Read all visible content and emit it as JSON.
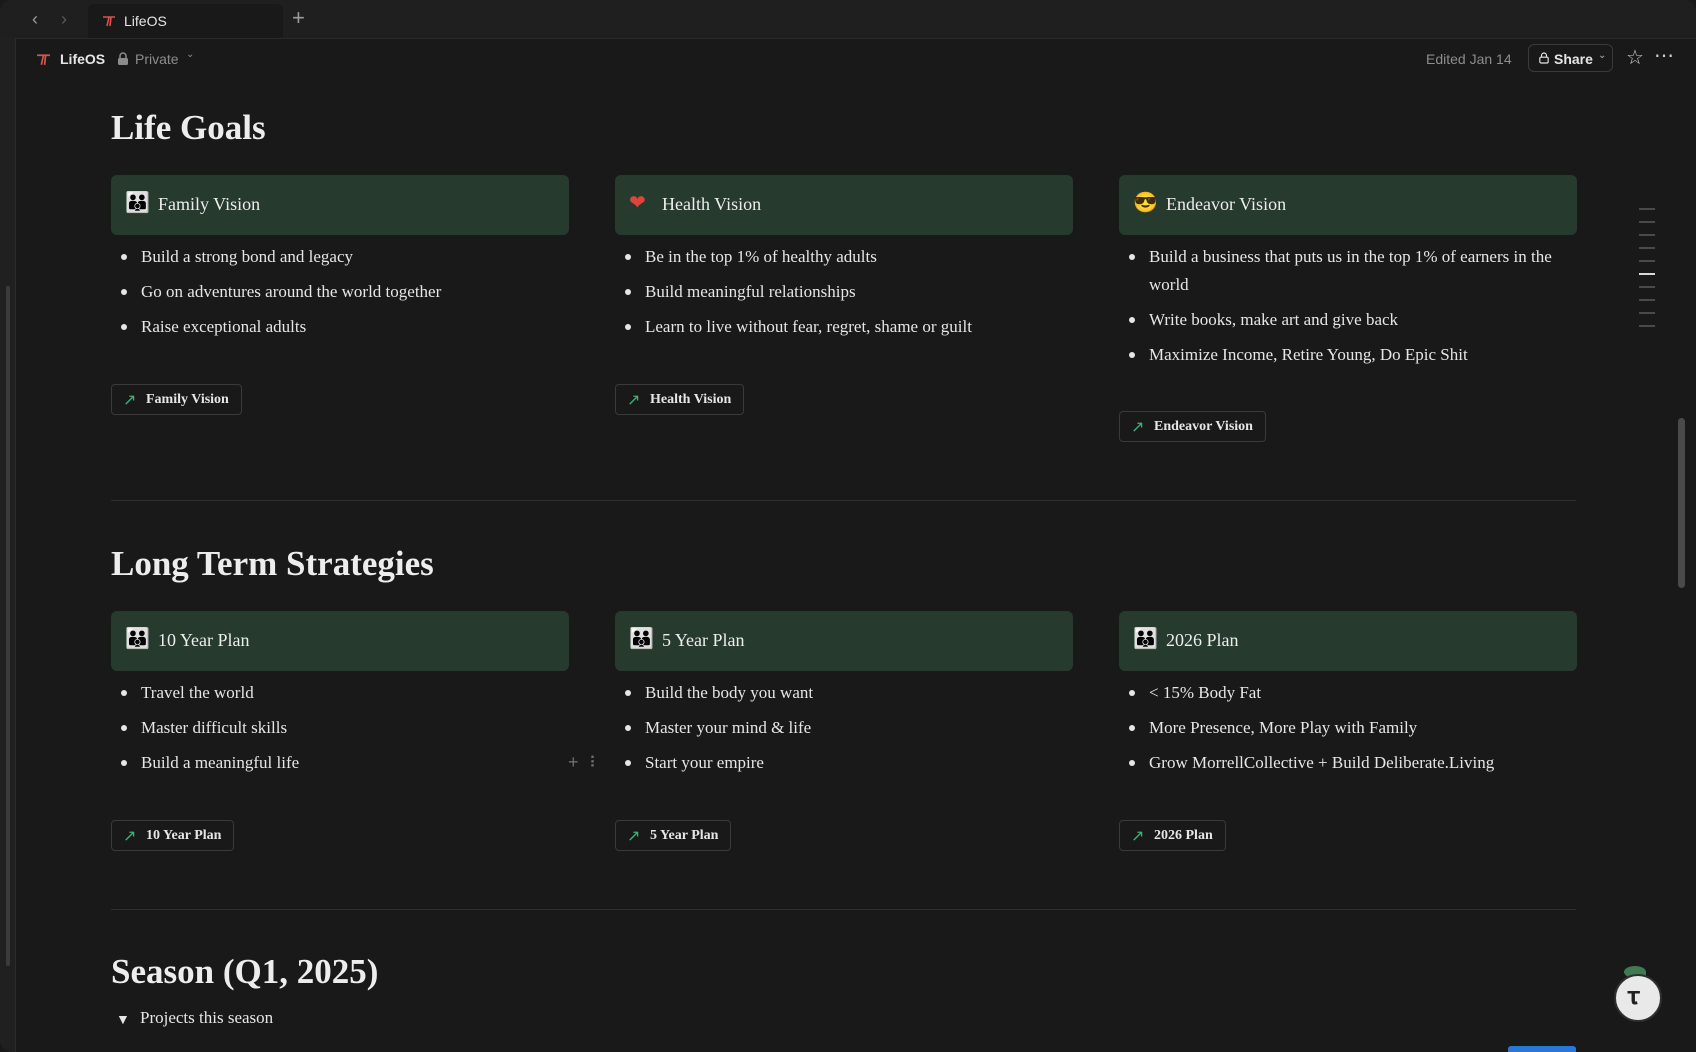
{
  "tab": {
    "title": "LifeOS"
  },
  "breadcrumb": {
    "title": "LifeOS",
    "privacy": "Private"
  },
  "topbar": {
    "edited": "Edited Jan 14",
    "share": "Share"
  },
  "sections": {
    "life_goals": {
      "title": "Life Goals",
      "cards": [
        {
          "title": "Family Vision",
          "icon": "family-icon",
          "items": [
            "Build a strong bond and legacy",
            "Go on adventures around the world together",
            "Raise exceptional adults"
          ],
          "link": "Family Vision"
        },
        {
          "title": "Health Vision",
          "icon": "heart-icon",
          "items": [
            "Be in the top 1% of healthy adults",
            "Build meaningful relationships",
            "Learn to live without fear, regret, shame or guilt"
          ],
          "link": "Health Vision"
        },
        {
          "title": "Endeavor Vision",
          "icon": "sunglasses-face-icon",
          "items": [
            "Build a business that puts us in the top 1% of earners in the world",
            "Write books, make art and give back",
            "Maximize Income, Retire Young, Do Epic Shit"
          ],
          "link": "Endeavor Vision"
        }
      ]
    },
    "long_term": {
      "title": "Long Term Strategies",
      "cards": [
        {
          "title": "10 Year Plan",
          "icon": "family-icon",
          "items": [
            "Travel the world",
            "Master difficult skills",
            "Build a meaningful life"
          ],
          "link": "10 Year Plan"
        },
        {
          "title": "5 Year Plan",
          "icon": "family-icon",
          "items": [
            "Build the body you want",
            "Master your mind & life",
            "Start your empire"
          ],
          "link": "5 Year Plan"
        },
        {
          "title": "2026 Plan",
          "icon": "family-icon",
          "items": [
            "< 15% Body Fat",
            "More Presence, More Play with Family",
            "Grow MorrellCollective + Build Deliberate.Living"
          ],
          "link": "2026 Plan"
        }
      ]
    },
    "season": {
      "title": "Season (Q1, 2025)",
      "toggle_label": "Projects this season"
    }
  },
  "colors": {
    "card_header": "#263a2d",
    "link_arrow": "#37b47a",
    "background": "#191919"
  }
}
